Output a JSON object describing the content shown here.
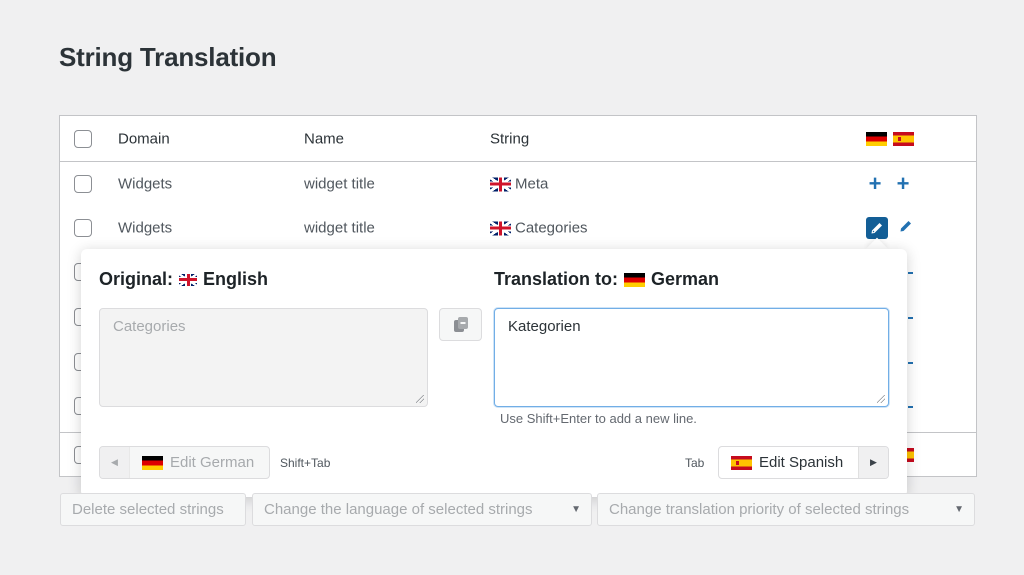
{
  "page": {
    "title": "String Translation"
  },
  "table": {
    "columns": [
      "Domain",
      "Name",
      "String"
    ],
    "language_columns": [
      {
        "code": "de",
        "icon": "flag-germany-icon"
      },
      {
        "code": "es",
        "icon": "flag-spain-icon"
      }
    ],
    "rows": [
      {
        "domain": "Widgets",
        "name": "widget title",
        "string": "Meta",
        "string_lang": "en",
        "actions": [
          "add",
          "add"
        ]
      },
      {
        "domain": "Widgets",
        "name": "widget title",
        "string": "Categories",
        "string_lang": "en",
        "actions": [
          "edit-active",
          "edit"
        ]
      }
    ]
  },
  "popup": {
    "original_label": "Original:",
    "original_language": "English",
    "original_text": "Categories",
    "translation_label": "Translation to:",
    "translation_language": "German",
    "translation_text": "Kategorien",
    "hint": "Use Shift+Enter to add a new line.",
    "prev_button": "Edit German",
    "prev_shortcut": "Shift+Tab",
    "next_button": "Edit Spanish",
    "next_shortcut": "Tab",
    "copy_icon": "copy-icon"
  },
  "bulk_actions": {
    "delete": "Delete selected strings",
    "change_language": "Change the language of selected strings",
    "change_priority": "Change translation priority of selected strings"
  },
  "colors": {
    "accent": "#2271b1",
    "accent_dark": "#135e96",
    "focus": "#72aee6",
    "background": "#f0f0f1"
  }
}
